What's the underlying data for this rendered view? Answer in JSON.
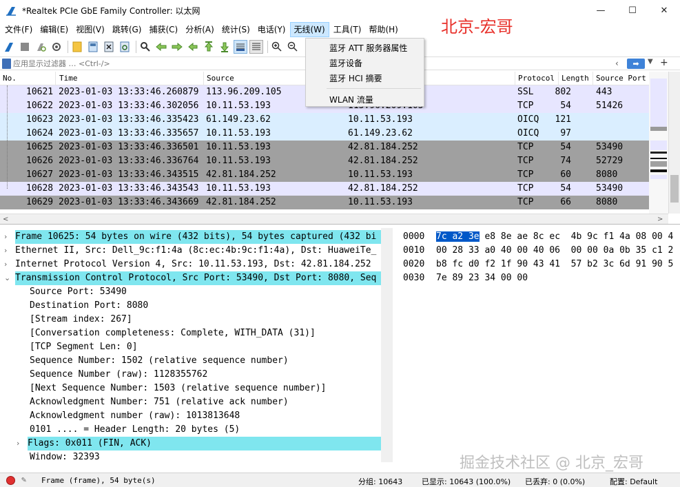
{
  "window": {
    "title": "*Realtek PCIe GbE Family Controller: 以太网",
    "minimize": "—",
    "maximize": "☐",
    "close": "✕"
  },
  "watermark_top": "北京-宏哥",
  "watermark_bottom": "掘金技术社区 @ 北京_宏哥",
  "menu": [
    "文件(F)",
    "编辑(E)",
    "视图(V)",
    "跳转(G)",
    "捕获(C)",
    "分析(A)",
    "统计(S)",
    "电话(Y)",
    "无线(W)",
    "工具(T)",
    "帮助(H)"
  ],
  "dropdown": {
    "items": [
      "蓝牙 ATT 服务器属性",
      "蓝牙设备",
      "蓝牙 HCI 摘要",
      "WLAN 流量"
    ]
  },
  "filter": {
    "placeholder": "应用显示过滤器 … <Ctrl-/>",
    "apply": "➡"
  },
  "packet_list": {
    "headers": [
      "No.",
      "Time",
      "Source",
      "Protocol",
      "Length",
      "Source Port"
    ],
    "rows": [
      {
        "no": "10621",
        "time": "2023-01-03 13:33:46.260879",
        "src": "113.96.209.105",
        "dst": "",
        "proto": "SSL",
        "len": "802",
        "sport": "443"
      },
      {
        "no": "10622",
        "time": "2023-01-03 13:33:46.302056",
        "src": "10.11.53.193",
        "dst": "113.96.209.105",
        "proto": "TCP",
        "len": "54",
        "sport": "51426"
      },
      {
        "no": "10623",
        "time": "2023-01-03 13:33:46.335423",
        "src": "61.149.23.62",
        "dst": "10.11.53.193",
        "proto": "OICQ",
        "len": "121",
        "sport": ""
      },
      {
        "no": "10624",
        "time": "2023-01-03 13:33:46.335657",
        "src": "10.11.53.193",
        "dst": "61.149.23.62",
        "proto": "OICQ",
        "len": "97",
        "sport": ""
      },
      {
        "no": "10625",
        "time": "2023-01-03 13:33:46.336501",
        "src": "10.11.53.193",
        "dst": "42.81.184.252",
        "proto": "TCP",
        "len": "54",
        "sport": "53490"
      },
      {
        "no": "10626",
        "time": "2023-01-03 13:33:46.336764",
        "src": "10.11.53.193",
        "dst": "42.81.184.252",
        "proto": "TCP",
        "len": "74",
        "sport": "52729"
      },
      {
        "no": "10627",
        "time": "2023-01-03 13:33:46.343515",
        "src": "42.81.184.252",
        "dst": "10.11.53.193",
        "proto": "TCP",
        "len": "60",
        "sport": "8080"
      },
      {
        "no": "10628",
        "time": "2023-01-03 13:33:46.343543",
        "src": "10.11.53.193",
        "dst": "42.81.184.252",
        "proto": "TCP",
        "len": "54",
        "sport": "53490"
      },
      {
        "no": "10629",
        "time": "2023-01-03 13:33:46.343669",
        "src": "42.81.184.252",
        "dst": "10.11.53.193",
        "proto": "TCP",
        "len": "66",
        "sport": "8080"
      }
    ],
    "row_colors": [
      "#e7e6ff",
      "#e7e6ff",
      "#daeeff",
      "#daeeff",
      "#a0a0a0",
      "#a0a0a0",
      "#a0a0a0",
      "#e7e6ff",
      "#a0a0a0"
    ]
  },
  "details": [
    {
      "text": "Frame 10625: 54 bytes on wire (432 bits), 54 bytes captured (432 bi",
      "toggle": "›",
      "hl": true
    },
    {
      "text": "Ethernet II, Src: Dell_9c:f1:4a (8c:ec:4b:9c:f1:4a), Dst: HuaweiTe_",
      "toggle": "›",
      "hl": false
    },
    {
      "text": "Internet Protocol Version 4, Src: 10.11.53.193, Dst: 42.81.184.252",
      "toggle": "›",
      "hl": false
    },
    {
      "text": "Transmission Control Protocol, Src Port: 53490, Dst Port: 8080, Seq",
      "toggle": "⌄",
      "hl": true
    },
    {
      "text": "Source Port: 53490",
      "toggle": "",
      "hl": false
    },
    {
      "text": "Destination Port: 8080",
      "toggle": "",
      "hl": false
    },
    {
      "text": "[Stream index: 267]",
      "toggle": "",
      "hl": false
    },
    {
      "text": "[Conversation completeness: Complete, WITH_DATA (31)]",
      "toggle": "",
      "hl": false
    },
    {
      "text": "[TCP Segment Len: 0]",
      "toggle": "",
      "hl": false
    },
    {
      "text": "Sequence Number: 1502    (relative sequence number)",
      "toggle": "",
      "hl": false
    },
    {
      "text": "Sequence Number (raw): 1128355762",
      "toggle": "",
      "hl": false
    },
    {
      "text": "[Next Sequence Number: 1503    (relative sequence number)]",
      "toggle": "",
      "hl": false
    },
    {
      "text": "Acknowledgment Number: 751    (relative ack number)",
      "toggle": "",
      "hl": false
    },
    {
      "text": "Acknowledgment number (raw): 1013813648",
      "toggle": "",
      "hl": false
    },
    {
      "text": "0101 .... = Header Length: 20 bytes (5)",
      "toggle": "",
      "hl": false
    },
    {
      "text": "Flags: 0x011 (FIN, ACK)",
      "toggle": "›",
      "hl": true
    },
    {
      "text": "Window: 32393",
      "toggle": "",
      "hl": false
    }
  ],
  "bytes": [
    {
      "offset": "0000",
      "sel": "7c a2 3e",
      "hex": " e8 8e ae 8c ec  4b 9c f1 4a 08 00 4"
    },
    {
      "offset": "0010",
      "sel": "",
      "hex": "00 28 33 a0 40 00 40 06  00 00 0a 0b 35 c1 2"
    },
    {
      "offset": "0020",
      "sel": "",
      "hex": "b8 fc d0 f2 1f 90 43 41  57 b2 3c 6d 91 90 5"
    },
    {
      "offset": "0030",
      "sel": "",
      "hex": "7e 89 23 34 00 00"
    }
  ],
  "status": {
    "frame": "Frame (frame), 54 byte(s)",
    "packets": "分组: 10643",
    "displayed": "已显示: 10643 (100.0%)",
    "dropped": "已丢弃: 0 (0.0%)",
    "profile": "配置: Default"
  }
}
